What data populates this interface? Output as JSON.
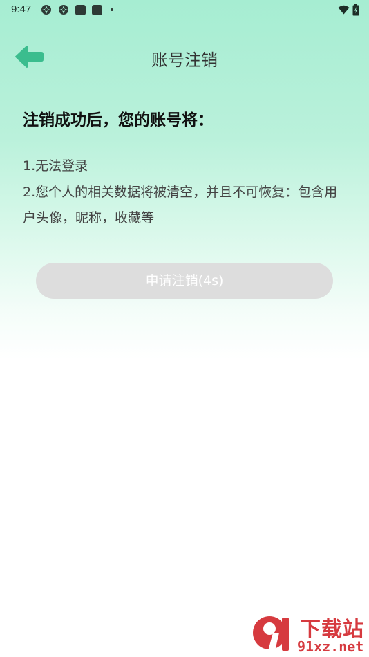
{
  "status_bar": {
    "time": "9:47",
    "left_icons": [
      "aperture-icon",
      "aperture-icon",
      "app-square-icon",
      "app-square-icon",
      "more-dot-icon"
    ],
    "right_icons": [
      "wifi-icon",
      "battery-icon"
    ]
  },
  "app_bar": {
    "back_icon": "arrow-left-icon",
    "title": "账号注销"
  },
  "content": {
    "heading": "注销成功后，您的账号将：",
    "items": [
      "1.无法登录",
      "2.您个人的相关数据将被清空，并且不可恢复：包含用",
      "户头像，昵称，收藏等"
    ]
  },
  "apply_button": {
    "label": "申请注销(4s)",
    "state": "disabled"
  },
  "watermark": {
    "title": "下载站",
    "url": "91xz.net"
  },
  "colors": {
    "accent": "#3bbd8e",
    "gradient_top": "#a6edd2",
    "button_disabled": "#dddddd",
    "watermark": "#d63a3f"
  }
}
